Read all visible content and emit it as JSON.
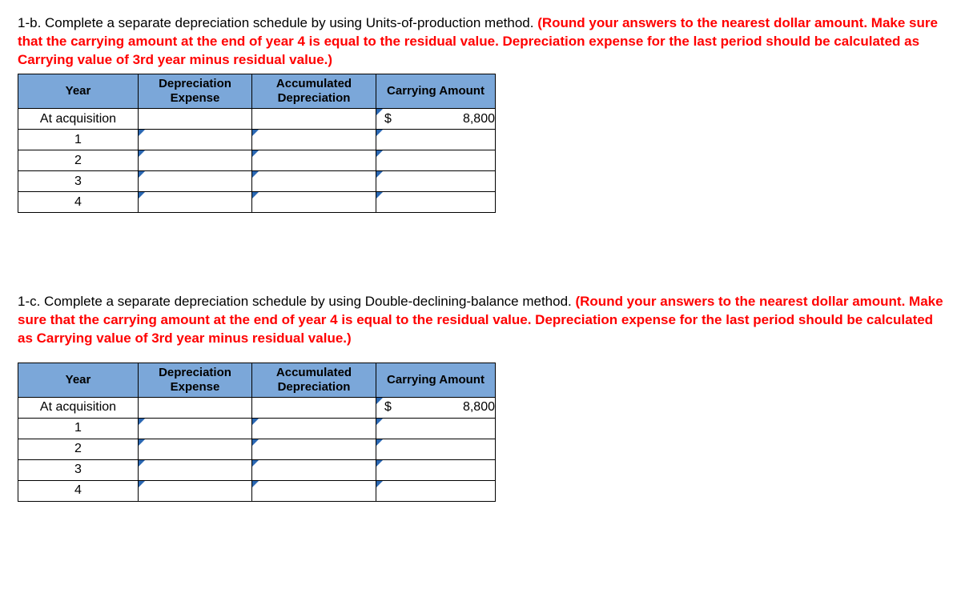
{
  "question_b": {
    "label": "1-b. Complete a separate depreciation schedule by using Units-of-production method. ",
    "hint": "(Round your answers to the nearest dollar amount. Make sure that the carrying amount at the end of year 4 is equal to the residual value. Depreciation expense for the last period should be calculated as Carrying value of 3rd year minus residual value.)"
  },
  "question_c": {
    "label": "1-c. Complete a separate depreciation schedule by using Double-declining-balance method. ",
    "hint": "(Round your answers to the nearest dollar amount. Make sure that the carrying amount at the end of year 4 is equal to the residual value. Depreciation expense for the last period should be calculated as Carrying value of 3rd year minus residual value.)"
  },
  "headers": {
    "year": "Year",
    "expense": "Depreciation Expense",
    "accumulated": "Accumulated Depreciation",
    "carrying": "Carrying Amount"
  },
  "rows": {
    "r0": "At acquisition",
    "r1": "1",
    "r2": "2",
    "r3": "3",
    "r4": "4"
  },
  "table_b": {
    "acq_carrying_currency": "$",
    "acq_carrying_value": "8,800"
  },
  "table_c": {
    "acq_carrying_currency": "$",
    "acq_carrying_value": "8,800"
  }
}
